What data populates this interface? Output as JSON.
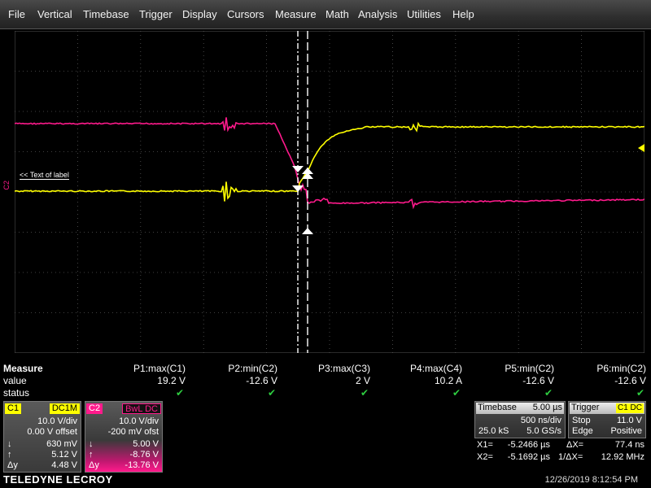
{
  "menu": [
    "File",
    "Vertical",
    "Timebase",
    "Trigger",
    "Display",
    "Cursors",
    "Measure",
    "Math",
    "Analysis",
    "Utilities",
    "Help"
  ],
  "colors": {
    "c1": "#ffff00",
    "c2": "#ff1a8c",
    "grid": "#555555",
    "cursor": "#ffffff",
    "check": "#2ecc40"
  },
  "grid": {
    "label": "<< Text of label",
    "c2_marker": "C2",
    "trigger_marker_icon": "left-triangle-icon"
  },
  "measure": {
    "title": "Measure",
    "row_value": "value",
    "row_status": "status",
    "params": [
      {
        "name": "P1:max(C1)",
        "value": "19.2 V",
        "status": "ok"
      },
      {
        "name": "P2:min(C2)",
        "value": "-12.6 V",
        "status": "ok"
      },
      {
        "name": "P3:max(C3)",
        "value": "2 V",
        "status": "ok"
      },
      {
        "name": "P4:max(C4)",
        "value": "10.2 A",
        "status": "ok"
      },
      {
        "name": "P5:min(C2)",
        "value": "-12.6 V",
        "status": "ok"
      },
      {
        "name": "P6:min(C2)",
        "value": "-12.6 V",
        "status": "ok"
      }
    ]
  },
  "c1": {
    "label": "C1",
    "coupling": "DC1M",
    "vdiv": "10.0 V/div",
    "offset": "0.00 V offset",
    "down_val": "630 mV",
    "up_val": "5.12 V",
    "dy_val": "4.48 V"
  },
  "c2": {
    "label": "C2",
    "coupling": "BwL DC",
    "vdiv": "10.0 V/div",
    "offset": "-200 mV ofst",
    "down_val": "5.00 V",
    "up_val": "-8.76 V",
    "dy_val": "-13.76 V"
  },
  "timebase": {
    "label": "Timebase",
    "value": "5.00 µs",
    "div": "500 ns/div",
    "samples": "25.0 kS",
    "rate": "5.0 GS/s"
  },
  "trigger": {
    "label": "Trigger",
    "badge": "C1 DC",
    "mode": "Stop",
    "level": "11.0 V",
    "type": "Edge",
    "slope": "Positive"
  },
  "cursors": {
    "x1_label": "X1=",
    "x1": "-5.2466 µs",
    "dx_label": "ΔX=",
    "dx": "77.4 ns",
    "x2_label": "X2=",
    "x2": "-5.1692 µs",
    "inv_label": "1/ΔX=",
    "inv": "12.92 MHz"
  },
  "footer": {
    "logo": "TELEDYNE LECROY",
    "datetime": "12/26/2019 8:12:54 PM"
  }
}
